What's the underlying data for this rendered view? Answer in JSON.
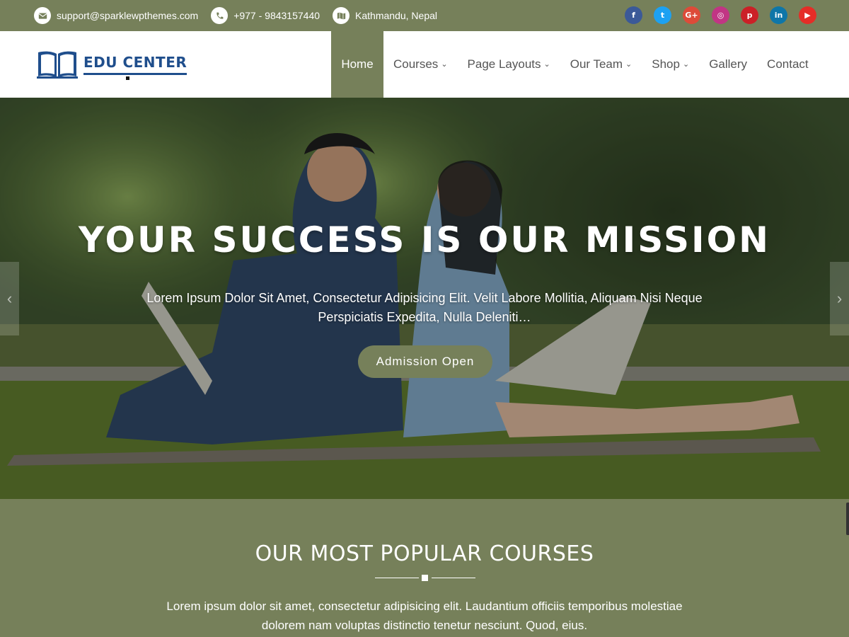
{
  "topbar": {
    "email": "support@sparklewpthemes.com",
    "phone": "+977 - 9843157440",
    "location": "Kathmandu, Nepal",
    "socials": [
      {
        "name": "facebook",
        "glyph": "f",
        "color": "#3b5998"
      },
      {
        "name": "twitter",
        "glyph": "t",
        "color": "#1da1f2"
      },
      {
        "name": "google-plus",
        "glyph": "G+",
        "color": "#dd4b39"
      },
      {
        "name": "instagram",
        "glyph": "◎",
        "color": "#c13584"
      },
      {
        "name": "pinterest",
        "glyph": "p",
        "color": "#cb2027"
      },
      {
        "name": "linkedin",
        "glyph": "in",
        "color": "#0e76a8"
      },
      {
        "name": "youtube",
        "glyph": "▶",
        "color": "#e52d27"
      }
    ]
  },
  "header": {
    "logo_text": "EDU CENTER",
    "nav": [
      {
        "label": "Home",
        "active": true,
        "dropdown": false
      },
      {
        "label": "Courses",
        "active": false,
        "dropdown": true
      },
      {
        "label": "Page Layouts",
        "active": false,
        "dropdown": true
      },
      {
        "label": "Our Team",
        "active": false,
        "dropdown": true
      },
      {
        "label": "Shop",
        "active": false,
        "dropdown": true
      },
      {
        "label": "Gallery",
        "active": false,
        "dropdown": false
      },
      {
        "label": "Contact",
        "active": false,
        "dropdown": false
      }
    ]
  },
  "hero": {
    "title": "YOUR SUCCESS IS OUR MISSION",
    "subtitle": "Lorem Ipsum Dolor Sit Amet, Consectetur Adipisicing Elit. Velit Labore Mollitia, Aliquam Nisi Neque Perspiciatis Expedita, Nulla Deleniti…",
    "button_label": "Admission Open"
  },
  "courses": {
    "title": "OUR MOST POPULAR COURSES",
    "description": "Lorem ipsum dolor sit amet, consectetur adipisicing elit. Laudantium officiis temporibus molestiae dolorem nam voluptas distinctio tenetur nesciunt. Quod, eius."
  },
  "colors": {
    "accent": "#76805a",
    "logo_blue": "#1f4e8c"
  }
}
